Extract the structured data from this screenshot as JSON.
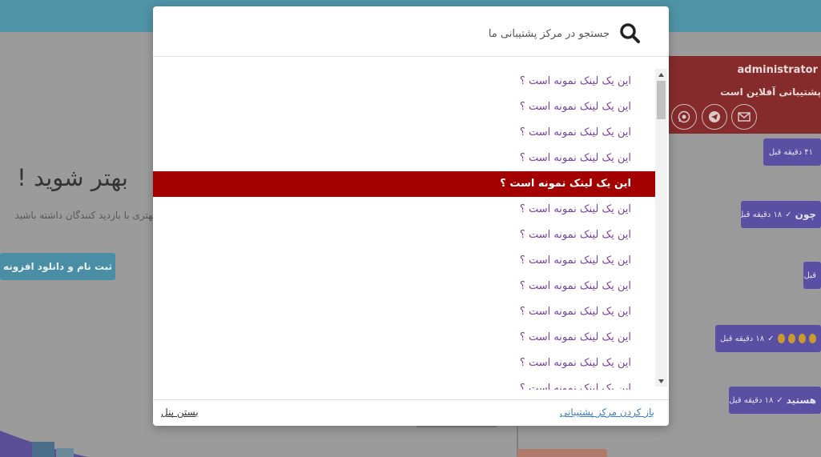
{
  "background": {
    "heading": "بهتر شوید !",
    "subtitle": "بهتری با بازدید کنندگان داشته باشید",
    "cta_label": "ثبت نام و دانلود افزونه"
  },
  "chat": {
    "admin_name": "administrator",
    "status": "پشتیبانی آفلاین است",
    "icons": [
      "envelope-icon",
      "telegram-icon",
      "whatsapp-icon"
    ],
    "bubbles": [
      {
        "time": "۴۱ دقیقه قبل",
        "text": ""
      },
      {
        "time": "۱۸ دقیقه قبل",
        "text": "چون"
      },
      {
        "time": "",
        "text": "قبل"
      },
      {
        "time": "۱۸ دقیقه قبل",
        "text": ""
      },
      {
        "time": "۱۸ دقیقه قبل",
        "text": "هستید"
      }
    ]
  },
  "modal": {
    "search_placeholder": "جستجو در مرکز پشتیبانی ما",
    "links": [
      "این یک لینک نمونه است ؟",
      "این یک لینک نمونه است ؟",
      "این یک لینک نمونه است ؟",
      "این یک لینک نمونه است ؟",
      "این یک لینک نمونه است ؟",
      "این یک لینک نمونه است ؟",
      "این یک لینک نمونه است ؟",
      "این یک لینک نمونه است ؟",
      "این یک لینک نمونه است ؟",
      "این یک لینک نمونه است ؟",
      "این یک لینک نمونه است ؟",
      "این یک لینک نمونه است ؟",
      "این یک لینک نمونه است ؟"
    ],
    "active_index": 4,
    "open_link": "باز کردن مرکز پشتیبانی",
    "close_link": "بستن پنل"
  },
  "colors": {
    "topbar": "#4f93a6",
    "active_row": "#a30000",
    "link": "#7b3fa0",
    "footer_link": "#3c7dc5",
    "chat_header": "#852b2b",
    "chat_bubble": "#5a4fa3"
  }
}
